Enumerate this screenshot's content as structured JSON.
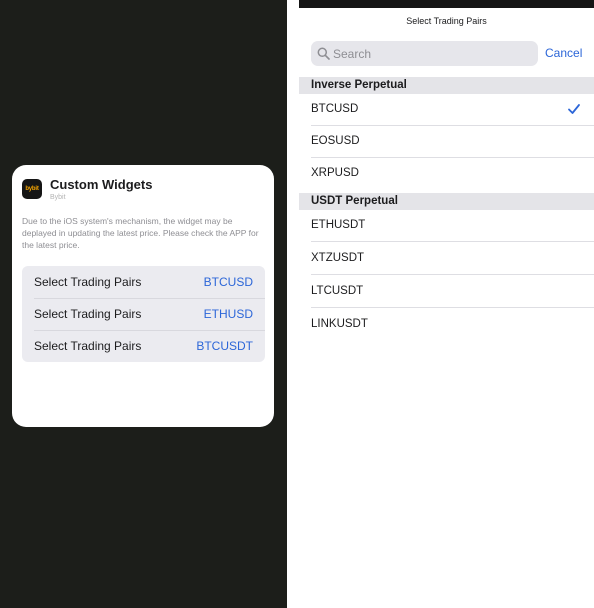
{
  "widget": {
    "app_icon_text": "bybit",
    "title": "Custom Widgets",
    "subtitle": "Bybit",
    "description": "Due to the iOS system's mechanism, the widget may be deplayed in updating the latest price. Please check the APP for the latest price.",
    "pairs": [
      {
        "label": "Select Trading Pairs",
        "value": "BTCUSD"
      },
      {
        "label": "Select Trading Pairs",
        "value": "ETHUSD"
      },
      {
        "label": "Select Trading Pairs",
        "value": "BTCUSDT"
      }
    ]
  },
  "picker": {
    "title": "Select Trading Pairs",
    "search_placeholder": "Search",
    "cancel_label": "Cancel",
    "sections": [
      {
        "header": "Inverse Perpetual",
        "items": [
          {
            "label": "BTCUSD",
            "selected": true
          },
          {
            "label": "EOSUSD",
            "selected": false
          },
          {
            "label": "XRPUSD",
            "selected": false
          }
        ]
      },
      {
        "header": "USDT Perpetual",
        "items": [
          {
            "label": "ETHUSDT",
            "selected": false
          },
          {
            "label": "XTZUSDT",
            "selected": false
          },
          {
            "label": "LTCUSDT",
            "selected": false
          },
          {
            "label": "LINKUSDT",
            "selected": false
          }
        ]
      }
    ]
  },
  "colors": {
    "background_dark": "#1c1e1a",
    "accent_blue": "#2c66d8",
    "brand_yellow": "#f7a600"
  },
  "icons": {
    "search": "search-icon",
    "checkmark": "checkmark-icon",
    "app": "bybit-app-icon"
  }
}
